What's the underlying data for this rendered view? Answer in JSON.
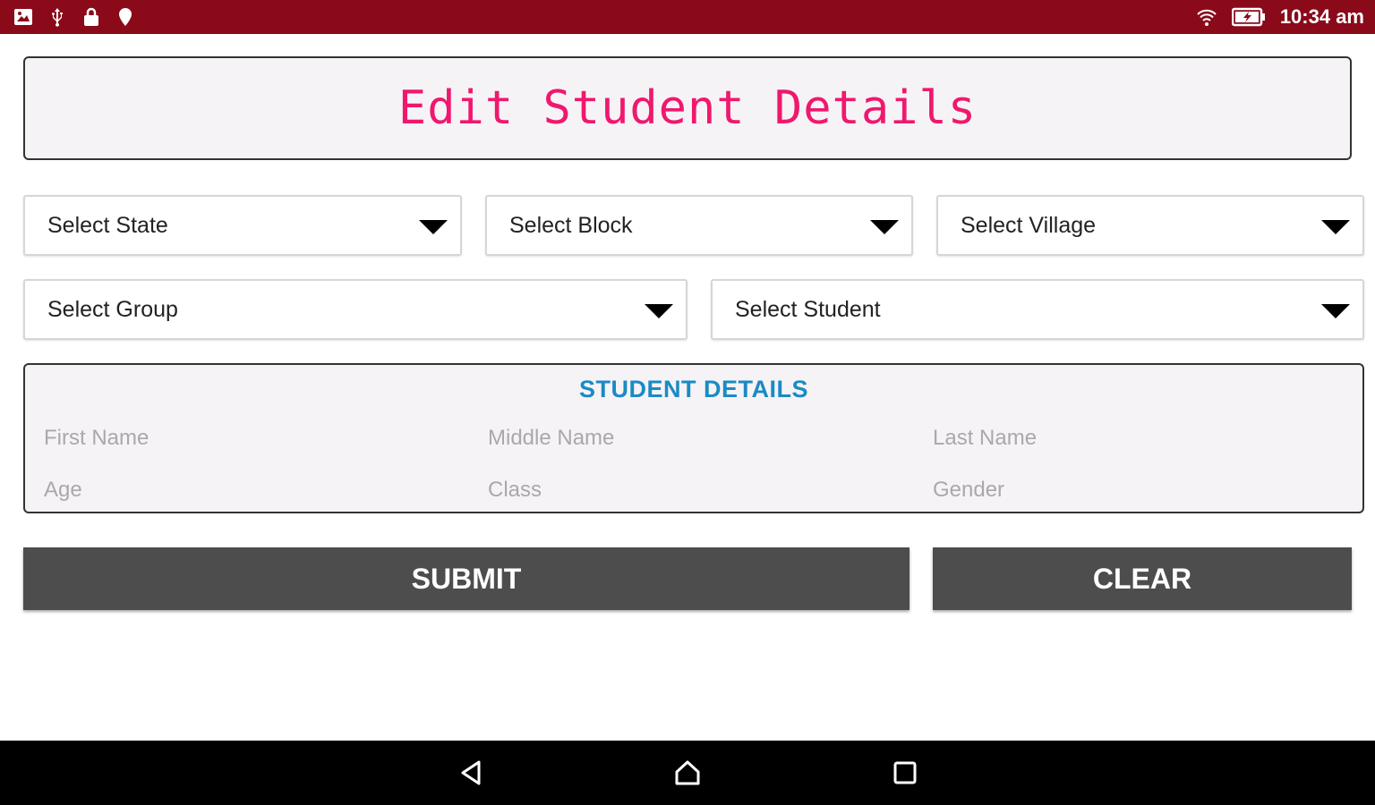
{
  "status_bar": {
    "left_icons": [
      "image-icon",
      "usb-icon",
      "lock-icon",
      "location-pin-icon"
    ],
    "right_icons": [
      "wifi-icon",
      "battery-charging-icon"
    ],
    "time": "10:34 am",
    "background": "#8a0a1a"
  },
  "header": {
    "title": "Edit Student Details",
    "title_color": "#f0186e"
  },
  "filters": {
    "state": {
      "selected": "Select State"
    },
    "block": {
      "selected": "Select Block"
    },
    "village": {
      "selected": "Select Village"
    },
    "group": {
      "selected": "Select Group"
    },
    "student": {
      "selected": "Select Student"
    }
  },
  "student_details": {
    "heading": "STUDENT DETAILS",
    "heading_color": "#1a8bc4",
    "fields": {
      "first_name": "First Name",
      "middle_name": "Middle Name",
      "last_name": "Last Name",
      "age": "Age",
      "class": "Class",
      "gender": "Gender"
    }
  },
  "actions": {
    "submit_label": "SUBMIT",
    "clear_label": "CLEAR",
    "button_color": "#4d4d4d"
  },
  "nav_bar": {
    "icons": [
      "back-icon",
      "home-icon",
      "recents-icon"
    ]
  }
}
